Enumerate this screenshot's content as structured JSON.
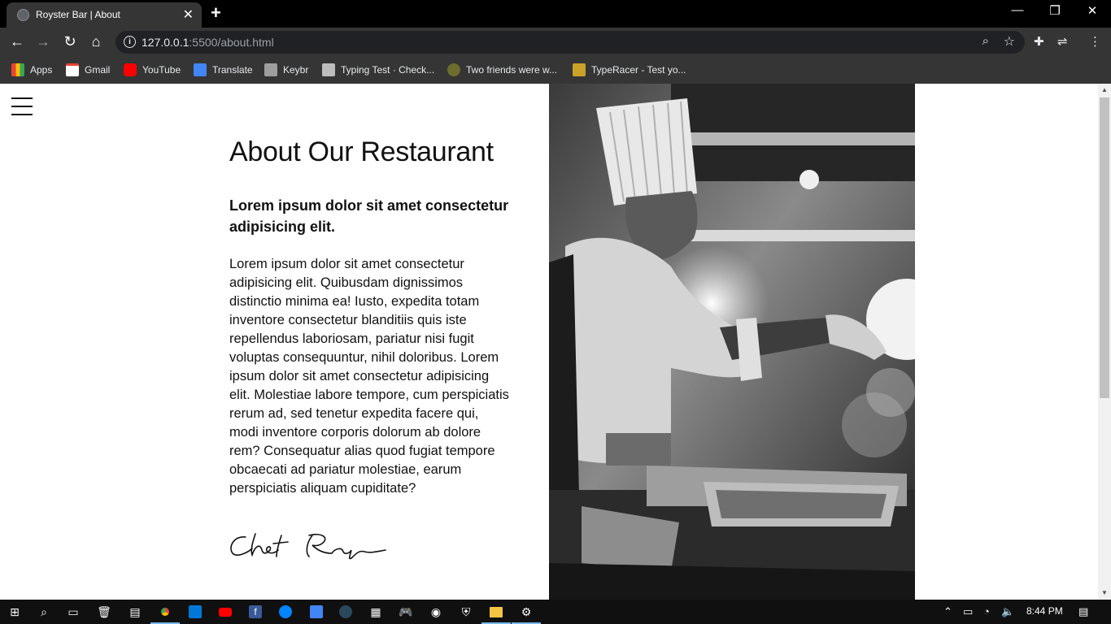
{
  "browser": {
    "tab_title": "Royster Bar | About",
    "url_host": "127.0.0.1",
    "url_rest": ":5500/about.html",
    "bookmarks": [
      {
        "label": "Apps",
        "color": "#4285f4"
      },
      {
        "label": "Gmail",
        "color": "#ea4335"
      },
      {
        "label": "YouTube",
        "color": "#ff0000"
      },
      {
        "label": "Translate",
        "color": "#4285f4"
      },
      {
        "label": "Keybr",
        "color": "#9e9e9e"
      },
      {
        "label": "Typing Test · Check...",
        "color": "#bdbdbd"
      },
      {
        "label": "Two friends were w...",
        "color": "#6d6d2d"
      },
      {
        "label": "TypeRacer - Test yo...",
        "color": "#c9a227"
      }
    ]
  },
  "page": {
    "title": "About Our Restaurant",
    "subtitle": "Lorem ipsum dolor sit amet consectetur adipisicing elit.",
    "body": "Lorem ipsum dolor sit amet consectetur adipisicing elit. Quibusdam dignissimos distinctio minima ea! Iusto, expedita totam inventore consectetur blanditiis quis iste repellendus laboriosam, pariatur nisi fugit voluptas consequuntur, nihil doloribus. Lorem ipsum dolor sit amet consectetur adipisicing elit. Molestiae labore tempore, cum perspiciatis rerum ad, sed tenetur expedita facere qui, modi inventore corporis dolorum ab dolore rem? Consequatur alias quod fugiat tempore obcaecati ad pariatur molestiae, earum perspiciatis aliquam cupiditate?",
    "signature": "Chef Royce"
  },
  "taskbar": {
    "time": "8:44 PM"
  },
  "colors": {
    "accent": "#76b9ed",
    "chrome_dark": "#353535"
  }
}
